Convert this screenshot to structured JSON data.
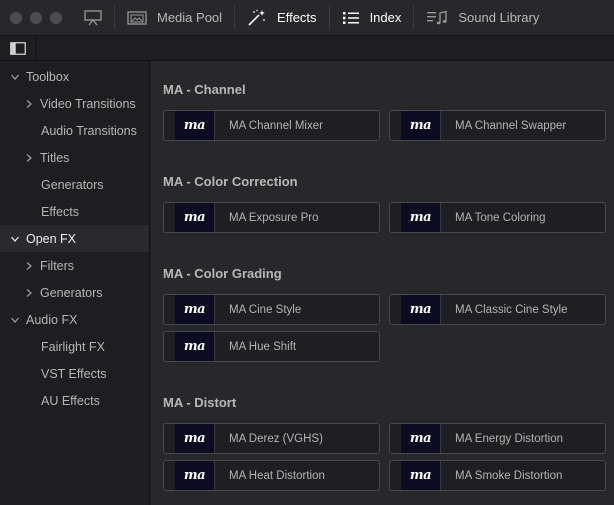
{
  "toolbar": {
    "window_controls": [
      "close",
      "minimize",
      "zoom"
    ],
    "tabs": [
      {
        "label": "Media Pool",
        "icon": "media-pool-icon"
      },
      {
        "label": "Effects",
        "icon": "effects-wand-icon",
        "active": true
      },
      {
        "label": "Index",
        "icon": "index-list-icon",
        "active": true
      },
      {
        "label": "Sound Library",
        "icon": "sound-library-icon"
      }
    ]
  },
  "sidebar": {
    "items": [
      {
        "label": "Toolbox",
        "expanded": true
      },
      {
        "label": "Video Transitions",
        "collapsed": true
      },
      {
        "label": "Audio Transitions"
      },
      {
        "label": "Titles",
        "collapsed": true
      },
      {
        "label": "Generators"
      },
      {
        "label": "Effects"
      },
      {
        "label": "Open FX",
        "expanded": true,
        "selected": true
      },
      {
        "label": "Filters",
        "collapsed": true
      },
      {
        "label": "Generators",
        "collapsed": true
      },
      {
        "label": "Audio FX",
        "expanded": true
      },
      {
        "label": "Fairlight FX"
      },
      {
        "label": "VST Effects"
      },
      {
        "label": "AU Effects"
      }
    ]
  },
  "main": {
    "thumb_text": "ma",
    "sections": [
      {
        "title": "MA - Channel",
        "effects": [
          "MA Channel Mixer",
          "MA Channel Swapper"
        ]
      },
      {
        "title": "MA - Color Correction",
        "effects": [
          "MA Exposure Pro",
          "MA Tone Coloring"
        ]
      },
      {
        "title": "MA - Color Grading",
        "effects": [
          "MA Cine Style",
          "MA Classic Cine Style",
          "MA Hue Shift"
        ]
      },
      {
        "title": "MA - Distort",
        "effects": [
          "MA Derez (VGHS)",
          "MA Energy Distortion",
          "MA Heat Distortion",
          "MA Smoke Distortion"
        ]
      }
    ]
  },
  "colors": {
    "background": "#28282b",
    "sidebar": "#1e1e21",
    "card": "#1f1f22",
    "thumb": "#0b0b22",
    "text": "#b8b8b8",
    "active_text": "#ffffff"
  }
}
